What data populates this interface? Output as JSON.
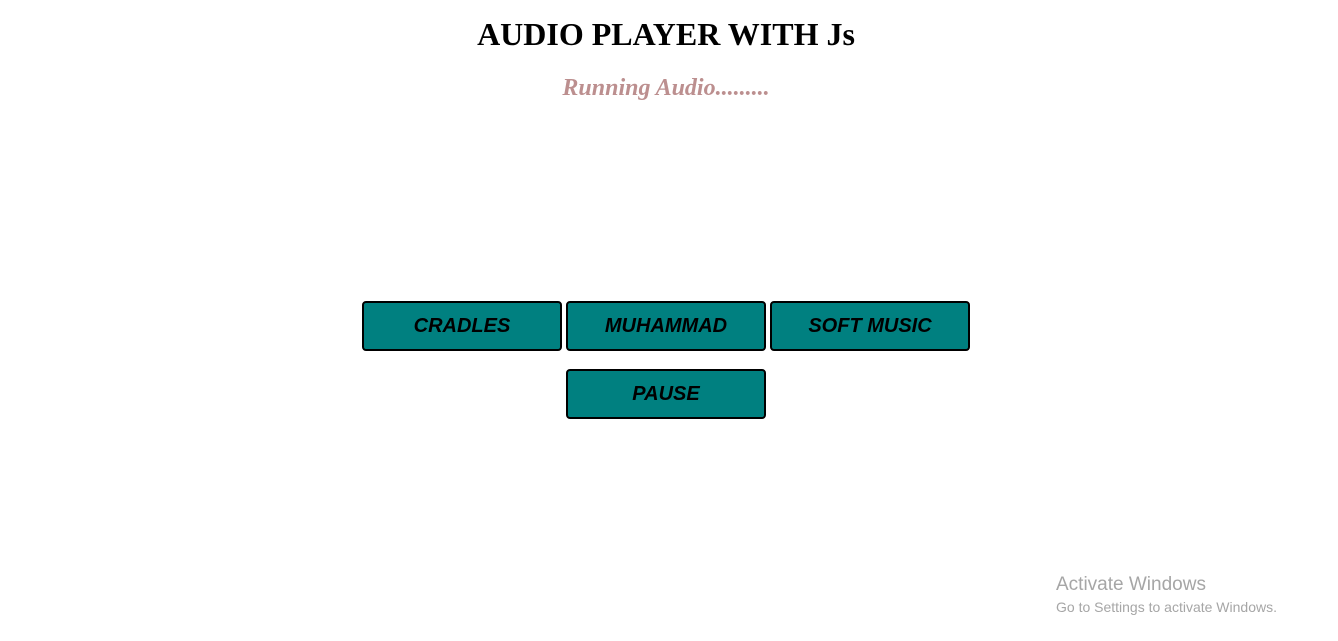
{
  "header": {
    "title": "AUDIO PLAYER WITH Js",
    "status": "Running Audio........."
  },
  "controls": {
    "tracks": [
      {
        "label": "CRADLES"
      },
      {
        "label": "MUHAMMAD"
      },
      {
        "label": "SOFT MUSIC"
      }
    ],
    "pause_label": "PAUSE"
  },
  "watermark": {
    "title": "Activate Windows",
    "subtitle": "Go to Settings to activate Windows."
  },
  "colors": {
    "button_bg": "#008080",
    "status_text": "#bc8f8f",
    "watermark": "#a6a6a6"
  }
}
